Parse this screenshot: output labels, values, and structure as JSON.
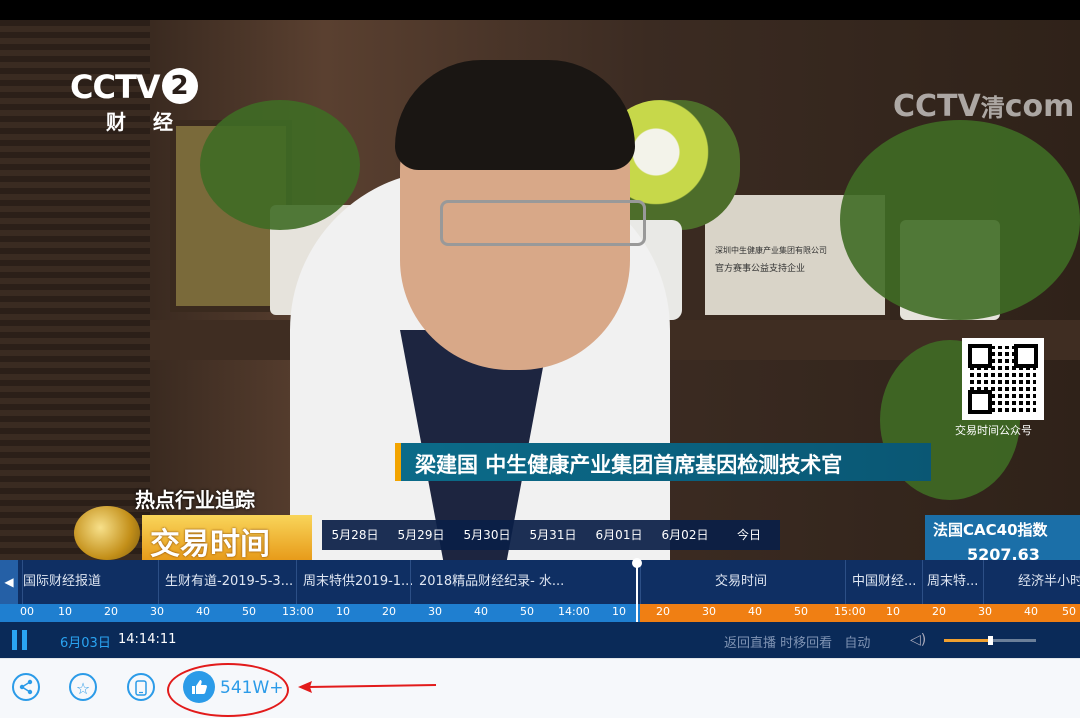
{
  "video": {
    "channel_logo": "CCTV",
    "channel_number": "2",
    "channel_name": "财 经",
    "watermark": "CCTV",
    "watermark_badge": "清",
    "watermark_suffix": "com",
    "qr_label": "交易时间公众号",
    "lower_third": "梁建国  中生健康产业集团首席基因检测技术官",
    "plaque_line1": "深圳中生健康产业集团有限公司",
    "plaque_line2": "官方赛事公益支持企业",
    "segment_title": "热点行业追踪",
    "program_title": "交易时间",
    "index_title": "法国CAC40指数",
    "index_value": "5207.63"
  },
  "epg": {
    "dates": [
      "5月28日",
      "5月29日",
      "5月30日",
      "5月31日",
      "6月01日",
      "6月02日",
      "今日"
    ],
    "programs": [
      "国际财经报道",
      "生财有道-2019-5-3...",
      "周末特供2019-1...",
      "2018精品财经纪录- 水...",
      "交易时间",
      "中国财经...",
      "周末特...",
      "经济半小时"
    ],
    "ruler_past": [
      "00",
      "10",
      "20",
      "30",
      "40",
      "50",
      "13:00",
      "10",
      "20",
      "30",
      "40",
      "50",
      "14:00",
      "10"
    ],
    "ruler_future": [
      "20",
      "30",
      "40",
      "50",
      "15:00",
      "10",
      "20",
      "30",
      "40",
      "50"
    ]
  },
  "controls": {
    "date": "6月03日",
    "time": "14:14:11",
    "back_live": "返回直播",
    "timeshift": "时移回看",
    "auto": "自动"
  },
  "bottom": {
    "like_count": "541W+"
  },
  "colors": {
    "accent": "#2b9be8",
    "annotation": "#e21b1b",
    "future_track": "#f07f13"
  }
}
